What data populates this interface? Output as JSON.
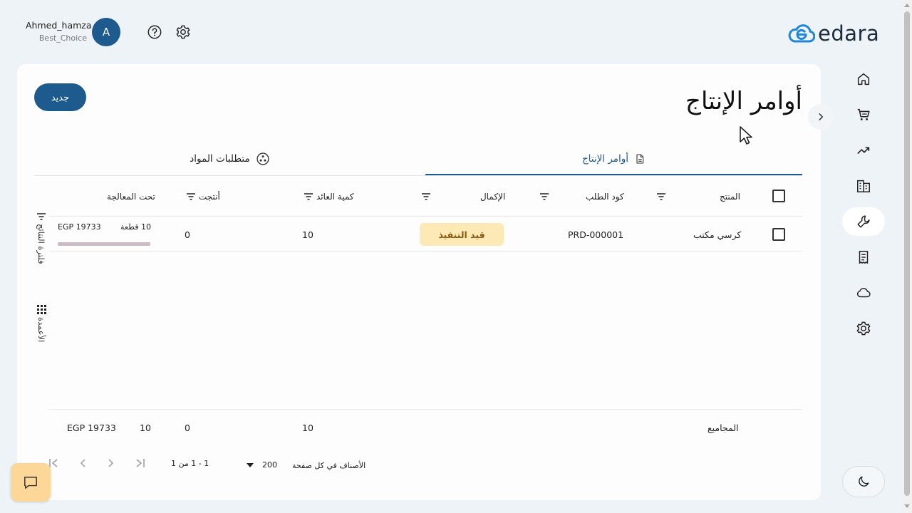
{
  "user": {
    "name": "Ahmed_hamza",
    "org": "Best_Choice",
    "avatar_letter": "A"
  },
  "brand": {
    "logo_text": "edara",
    "accent": "#1d5a8e"
  },
  "page": {
    "title": "أوامر الإنتاج",
    "new_button": "جديد"
  },
  "tabs": [
    {
      "label": "أوامر الإنتاج",
      "icon": "document-icon",
      "active": true
    },
    {
      "label": "متطلبات المواد",
      "icon": "dots-circle-icon",
      "active": false
    }
  ],
  "table": {
    "headers": {
      "product": "المنتج",
      "order_code": "كود الطلب",
      "completion": "الإكمال",
      "returned_qty": "كمية العائد",
      "produced": "أنتجت",
      "in_process": "تحت المعالجة"
    },
    "rows": [
      {
        "product": "كرسي مكتب",
        "order_code": "PRD-000001",
        "status": "قيد التنفيذ",
        "returned_qty": "10",
        "produced": "0",
        "in_process_qty": "10 قطعة",
        "in_process_amount": "EGP 19733",
        "progress": 1.0
      }
    ],
    "totals": {
      "label": "المجاميع",
      "returned_qty": "10",
      "produced": "0",
      "in_process_qty": "10",
      "in_process_amount": "EGP 19733"
    }
  },
  "side_tools": {
    "filter_label": "فلترة النتائج",
    "columns_label": "الأعمدة"
  },
  "pagination": {
    "range": "1 - 1 من 1",
    "page_size": "200",
    "page_size_label": "الأصناف في كل صفحة"
  },
  "sidebar_icons": [
    "home-icon",
    "cart-icon",
    "trending-icon",
    "building-icon",
    "wrench-icon",
    "receipt-icon",
    "cloud-icon",
    "gear-icon"
  ],
  "sidebar_active": "wrench-icon"
}
